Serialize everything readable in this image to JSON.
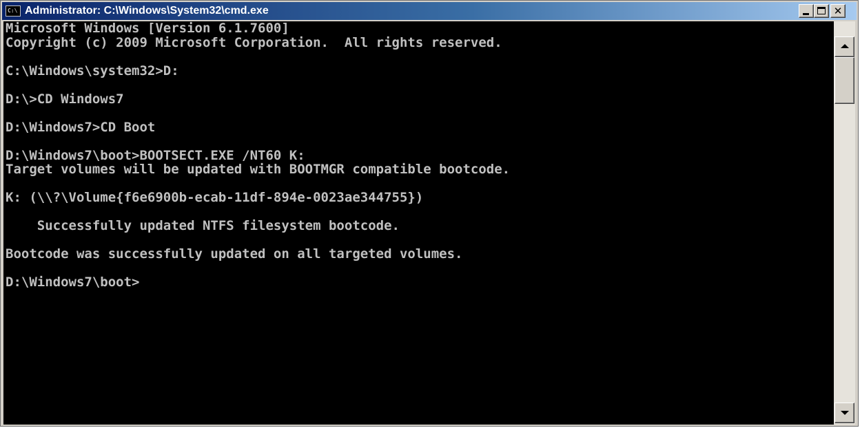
{
  "window": {
    "title": "Administrator: C:\\Windows\\System32\\cmd.exe",
    "icon_text": "C:\\",
    "buttons": {
      "minimize_icon": "minimize-icon",
      "maximize_icon": "maximize-icon",
      "close_icon": "close-icon",
      "close_glyph": "✕"
    }
  },
  "console": {
    "lines": [
      "Microsoft Windows [Version 6.1.7600]",
      "Copyright (c) 2009 Microsoft Corporation.  All rights reserved.",
      "",
      "C:\\Windows\\system32>D:",
      "",
      "D:\\>CD Windows7",
      "",
      "D:\\Windows7>CD Boot",
      "",
      "D:\\Windows7\\boot>BOOTSECT.EXE /NT60 K:",
      "Target volumes will be updated with BOOTMGR compatible bootcode.",
      "",
      "K: (\\\\?\\Volume{f6e6900b-ecab-11df-894e-0023ae344755})",
      "",
      "    Successfully updated NTFS filesystem bootcode.",
      "",
      "Bootcode was successfully updated on all targeted volumes.",
      "",
      "D:\\Windows7\\boot>"
    ]
  },
  "colors": {
    "console_background": "#000000",
    "console_text": "#c0c0c0",
    "title_gradient_start": "#0a246a",
    "title_gradient_end": "#a6caf0"
  }
}
